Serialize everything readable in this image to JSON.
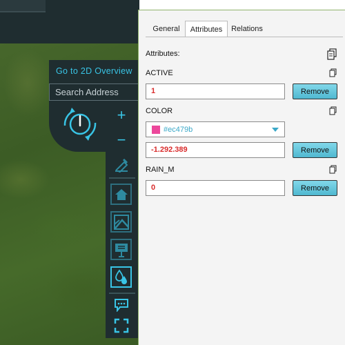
{
  "map": {
    "overview_link": "Go to 2D Overview",
    "search_placeholder": "Search Address"
  },
  "toolbar": {
    "zoom_in": "+",
    "zoom_out": "−",
    "icons": [
      "ruler-icon",
      "home-icon",
      "map-image-icon",
      "billboard-icon",
      "water-drops-icon",
      "chat-icon",
      "fullscreen-icon"
    ]
  },
  "panel": {
    "tabs": [
      {
        "label": "General",
        "active": false
      },
      {
        "label": "Attributes",
        "active": true
      },
      {
        "label": "Relations",
        "active": false
      }
    ],
    "heading": "Attributes:",
    "attributes": [
      {
        "name": "ACTIVE",
        "value": "1",
        "remove_label": "Remove"
      },
      {
        "name": "COLOR",
        "color": "#ec479b",
        "value": "-1.292.389",
        "remove_label": "Remove"
      },
      {
        "name": "RAIN_M",
        "value": "0",
        "remove_label": "Remove"
      }
    ]
  },
  "colors": {
    "accent": "#39c5e6",
    "value_text": "#d92b2b",
    "toolbar_bg": "#1f2d30"
  }
}
